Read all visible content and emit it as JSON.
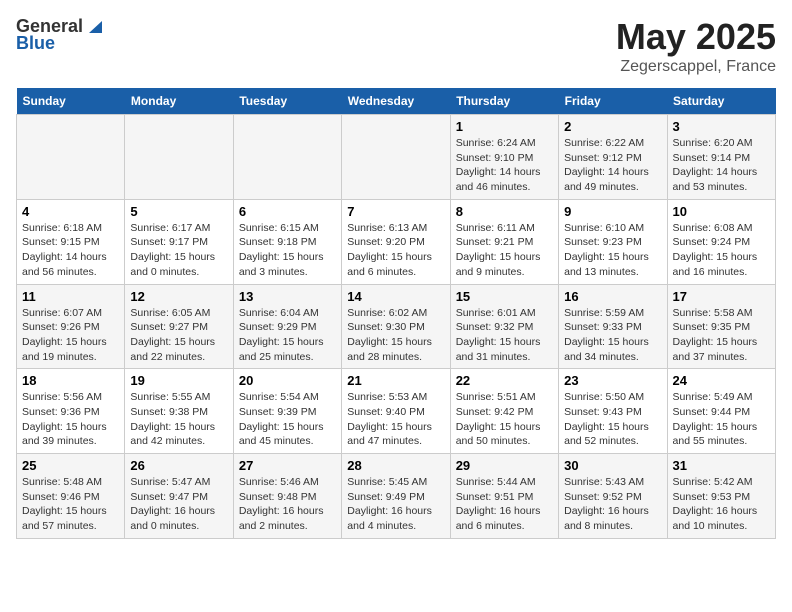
{
  "header": {
    "logo_general": "General",
    "logo_blue": "Blue",
    "month": "May 2025",
    "location": "Zegerscappel, France"
  },
  "days_of_week": [
    "Sunday",
    "Monday",
    "Tuesday",
    "Wednesday",
    "Thursday",
    "Friday",
    "Saturday"
  ],
  "weeks": [
    [
      {
        "day": "",
        "info": ""
      },
      {
        "day": "",
        "info": ""
      },
      {
        "day": "",
        "info": ""
      },
      {
        "day": "",
        "info": ""
      },
      {
        "day": "1",
        "info": "Sunrise: 6:24 AM\nSunset: 9:10 PM\nDaylight: 14 hours\nand 46 minutes."
      },
      {
        "day": "2",
        "info": "Sunrise: 6:22 AM\nSunset: 9:12 PM\nDaylight: 14 hours\nand 49 minutes."
      },
      {
        "day": "3",
        "info": "Sunrise: 6:20 AM\nSunset: 9:14 PM\nDaylight: 14 hours\nand 53 minutes."
      }
    ],
    [
      {
        "day": "4",
        "info": "Sunrise: 6:18 AM\nSunset: 9:15 PM\nDaylight: 14 hours\nand 56 minutes."
      },
      {
        "day": "5",
        "info": "Sunrise: 6:17 AM\nSunset: 9:17 PM\nDaylight: 15 hours\nand 0 minutes."
      },
      {
        "day": "6",
        "info": "Sunrise: 6:15 AM\nSunset: 9:18 PM\nDaylight: 15 hours\nand 3 minutes."
      },
      {
        "day": "7",
        "info": "Sunrise: 6:13 AM\nSunset: 9:20 PM\nDaylight: 15 hours\nand 6 minutes."
      },
      {
        "day": "8",
        "info": "Sunrise: 6:11 AM\nSunset: 9:21 PM\nDaylight: 15 hours\nand 9 minutes."
      },
      {
        "day": "9",
        "info": "Sunrise: 6:10 AM\nSunset: 9:23 PM\nDaylight: 15 hours\nand 13 minutes."
      },
      {
        "day": "10",
        "info": "Sunrise: 6:08 AM\nSunset: 9:24 PM\nDaylight: 15 hours\nand 16 minutes."
      }
    ],
    [
      {
        "day": "11",
        "info": "Sunrise: 6:07 AM\nSunset: 9:26 PM\nDaylight: 15 hours\nand 19 minutes."
      },
      {
        "day": "12",
        "info": "Sunrise: 6:05 AM\nSunset: 9:27 PM\nDaylight: 15 hours\nand 22 minutes."
      },
      {
        "day": "13",
        "info": "Sunrise: 6:04 AM\nSunset: 9:29 PM\nDaylight: 15 hours\nand 25 minutes."
      },
      {
        "day": "14",
        "info": "Sunrise: 6:02 AM\nSunset: 9:30 PM\nDaylight: 15 hours\nand 28 minutes."
      },
      {
        "day": "15",
        "info": "Sunrise: 6:01 AM\nSunset: 9:32 PM\nDaylight: 15 hours\nand 31 minutes."
      },
      {
        "day": "16",
        "info": "Sunrise: 5:59 AM\nSunset: 9:33 PM\nDaylight: 15 hours\nand 34 minutes."
      },
      {
        "day": "17",
        "info": "Sunrise: 5:58 AM\nSunset: 9:35 PM\nDaylight: 15 hours\nand 37 minutes."
      }
    ],
    [
      {
        "day": "18",
        "info": "Sunrise: 5:56 AM\nSunset: 9:36 PM\nDaylight: 15 hours\nand 39 minutes."
      },
      {
        "day": "19",
        "info": "Sunrise: 5:55 AM\nSunset: 9:38 PM\nDaylight: 15 hours\nand 42 minutes."
      },
      {
        "day": "20",
        "info": "Sunrise: 5:54 AM\nSunset: 9:39 PM\nDaylight: 15 hours\nand 45 minutes."
      },
      {
        "day": "21",
        "info": "Sunrise: 5:53 AM\nSunset: 9:40 PM\nDaylight: 15 hours\nand 47 minutes."
      },
      {
        "day": "22",
        "info": "Sunrise: 5:51 AM\nSunset: 9:42 PM\nDaylight: 15 hours\nand 50 minutes."
      },
      {
        "day": "23",
        "info": "Sunrise: 5:50 AM\nSunset: 9:43 PM\nDaylight: 15 hours\nand 52 minutes."
      },
      {
        "day": "24",
        "info": "Sunrise: 5:49 AM\nSunset: 9:44 PM\nDaylight: 15 hours\nand 55 minutes."
      }
    ],
    [
      {
        "day": "25",
        "info": "Sunrise: 5:48 AM\nSunset: 9:46 PM\nDaylight: 15 hours\nand 57 minutes."
      },
      {
        "day": "26",
        "info": "Sunrise: 5:47 AM\nSunset: 9:47 PM\nDaylight: 16 hours\nand 0 minutes."
      },
      {
        "day": "27",
        "info": "Sunrise: 5:46 AM\nSunset: 9:48 PM\nDaylight: 16 hours\nand 2 minutes."
      },
      {
        "day": "28",
        "info": "Sunrise: 5:45 AM\nSunset: 9:49 PM\nDaylight: 16 hours\nand 4 minutes."
      },
      {
        "day": "29",
        "info": "Sunrise: 5:44 AM\nSunset: 9:51 PM\nDaylight: 16 hours\nand 6 minutes."
      },
      {
        "day": "30",
        "info": "Sunrise: 5:43 AM\nSunset: 9:52 PM\nDaylight: 16 hours\nand 8 minutes."
      },
      {
        "day": "31",
        "info": "Sunrise: 5:42 AM\nSunset: 9:53 PM\nDaylight: 16 hours\nand 10 minutes."
      }
    ]
  ]
}
